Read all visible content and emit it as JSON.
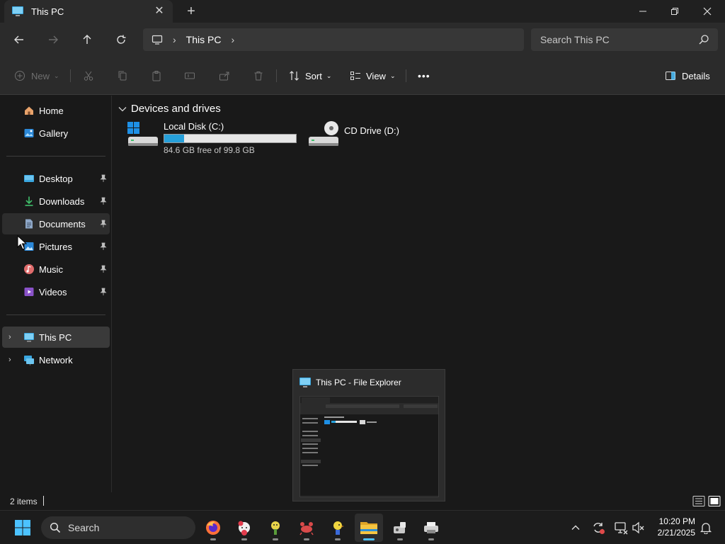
{
  "window": {
    "tab_title": "This PC",
    "new_tab_symbol": "+",
    "close_symbol": "✕"
  },
  "address": {
    "crumbs": [
      "This PC"
    ],
    "search_placeholder": "Search This PC"
  },
  "toolbar": {
    "new_label": "New",
    "sort_label": "Sort",
    "view_label": "View",
    "details_label": "Details",
    "more_label": "•••"
  },
  "sidebar": {
    "items": [
      {
        "label": "Home",
        "icon": "home-icon"
      },
      {
        "label": "Gallery",
        "icon": "gallery-icon"
      },
      {
        "label": "Desktop",
        "icon": "desktop-icon",
        "pinned": true
      },
      {
        "label": "Downloads",
        "icon": "download-icon",
        "pinned": true
      },
      {
        "label": "Documents",
        "icon": "documents-icon",
        "pinned": true,
        "state": "hover"
      },
      {
        "label": "Pictures",
        "icon": "pictures-icon",
        "pinned": true
      },
      {
        "label": "Music",
        "icon": "music-icon",
        "pinned": true
      },
      {
        "label": "Videos",
        "icon": "videos-icon",
        "pinned": true
      },
      {
        "label": "This PC",
        "icon": "this-pc-icon",
        "expandable": true,
        "state": "selected"
      },
      {
        "label": "Network",
        "icon": "network-icon",
        "expandable": true
      }
    ]
  },
  "content": {
    "group_label": "Devices and drives",
    "drives": [
      {
        "name": "Local Disk (C:)",
        "free_text": "84.6 GB free of 99.8 GB",
        "used_fraction": 0.152,
        "icon": "local-disk-icon"
      },
      {
        "name": "CD Drive (D:)",
        "icon": "cd-drive-icon"
      }
    ]
  },
  "status": {
    "item_count": "2 items"
  },
  "preview": {
    "title": "This PC - File Explorer"
  },
  "taskbar": {
    "search_label": "Search",
    "time": "10:20 PM",
    "date": "2/21/2025",
    "apps": [
      "firefox-icon",
      "hello-kitty-icon",
      "flower-app-icon",
      "crab-app-icon",
      "bird-app-icon",
      "file-explorer-icon",
      "rocket-app-icon",
      "printer-app-icon"
    ]
  },
  "colors": {
    "accent": "#4cc2ff",
    "drive_fill": "#26a0da",
    "folder_yellow": "#f5c542"
  }
}
